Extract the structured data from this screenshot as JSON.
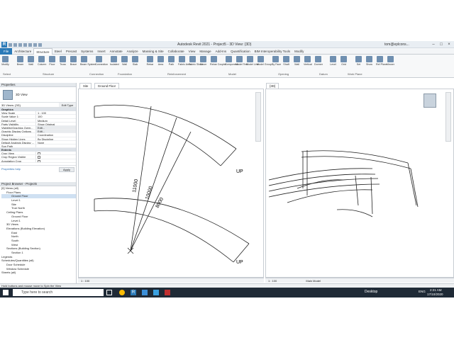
{
  "window": {
    "title": "Autodesk Revit 2021 - Project5 - 3D View: {3D}",
    "user": "tom@eplcons...",
    "qat_icons": [
      "open-icon",
      "save-icon",
      "sync-icon",
      "undo-icon",
      "redo-icon",
      "print-icon",
      "measure-icon"
    ]
  },
  "ribbon": {
    "tabs": [
      "File",
      "Architecture",
      "Structure",
      "Steel",
      "Precast",
      "Systems",
      "Insert",
      "Annotate",
      "Analyze",
      "Massing & Site",
      "Collaborate",
      "View",
      "Manage",
      "Add-Ins",
      "Quantification",
      "BIM Interoperability Tools",
      "Modify"
    ],
    "active_tab": "Structure",
    "buttons": [
      "Modify",
      "Beam",
      "Wall",
      "Column",
      "Floor",
      "Truss",
      "Brace",
      "Beam System",
      "Connection",
      "Isolated",
      "Wall",
      "Slab",
      "Rebar",
      "Area",
      "Path",
      "Fabric Area",
      "Fabric Sheet",
      "Cover",
      "Rebar Coupler",
      "Component",
      "Model Text",
      "Model Line",
      "Model Group",
      "By Face",
      "Shaft",
      "Wall",
      "Vertical",
      "Dormer",
      "Level",
      "Grid",
      "Set",
      "Show",
      "Ref Plane",
      "Viewer"
    ],
    "panels": [
      "Select",
      "Structure",
      "Connection",
      "Foundation",
      "Reinforcement",
      "Model",
      "Opening",
      "Datum",
      "Work Plane"
    ]
  },
  "properties": {
    "title": "Properties",
    "type": "3D View",
    "selector": "3D Views: {3D}",
    "edit_type": "Edit Type",
    "categories": [
      "Graphics",
      "Extents"
    ],
    "rows": [
      {
        "k": "View Scale",
        "v": "1 : 100"
      },
      {
        "k": "Scale Value    1:",
        "v": "100"
      },
      {
        "k": "Detail Level",
        "v": "Medium"
      },
      {
        "k": "Parts Visibility",
        "v": "Show Original"
      },
      {
        "k": "Visibility/Graphics Overr...",
        "v": "Edit..."
      },
      {
        "k": "Graphic Display Options",
        "v": "Edit..."
      },
      {
        "k": "Discipline",
        "v": "Coordination"
      },
      {
        "k": "Show Hidden Lines",
        "v": "By Discipline"
      },
      {
        "k": "Default Analysis Display ...",
        "v": "None"
      },
      {
        "k": "Sun Path",
        "v": ""
      }
    ],
    "extents": [
      "Crop View",
      "Crop Region Visible",
      "Annotation Crop"
    ],
    "help": "Properties help",
    "apply": "Apply"
  },
  "browser": {
    "title": "Project Browser - Project5",
    "items": [
      {
        "label": "[0] Views (all)",
        "indent": 0
      },
      {
        "label": "Floor Plans",
        "indent": 1
      },
      {
        "label": "Ground Floor",
        "indent": 2,
        "selected": true
      },
      {
        "label": "Level 1",
        "indent": 2
      },
      {
        "label": "Site",
        "indent": 2
      },
      {
        "label": "True North",
        "indent": 2
      },
      {
        "label": "Ceiling Plans",
        "indent": 1
      },
      {
        "label": "Ground Floor",
        "indent": 2
      },
      {
        "label": "Level 1",
        "indent": 2
      },
      {
        "label": "3D Views",
        "indent": 1
      },
      {
        "label": "Elevations (Building Elevation)",
        "indent": 1
      },
      {
        "label": "East",
        "indent": 2
      },
      {
        "label": "North",
        "indent": 2
      },
      {
        "label": "South",
        "indent": 2
      },
      {
        "label": "West",
        "indent": 2
      },
      {
        "label": "Sections (Building Section)",
        "indent": 1
      },
      {
        "label": "Section 1",
        "indent": 2
      },
      {
        "label": "Legends",
        "indent": 0
      },
      {
        "label": "Schedules/Quantities (all)",
        "indent": 0
      },
      {
        "label": "Door Schedule",
        "indent": 1
      },
      {
        "label": "Window Schedule",
        "indent": 1
      },
      {
        "label": "Sheets (all)",
        "indent": 0
      }
    ]
  },
  "views": {
    "tab1": "Site",
    "tab2": "Ground Floor",
    "tab3": "{3D}",
    "dims": [
      "11000",
      "10000",
      "8000"
    ],
    "up_labels": [
      "UP",
      "UP"
    ],
    "scale_left": "1 : 100",
    "scale_right": "1 : 100",
    "main_model": "Main Model"
  },
  "status": {
    "text": "Hold buttons and mouse move to Spin the View"
  },
  "taskbar": {
    "search": "Type here to search",
    "desktop": "Desktop",
    "lang": "ENG",
    "time": "2:21 AM",
    "date": "17/10/2020"
  }
}
